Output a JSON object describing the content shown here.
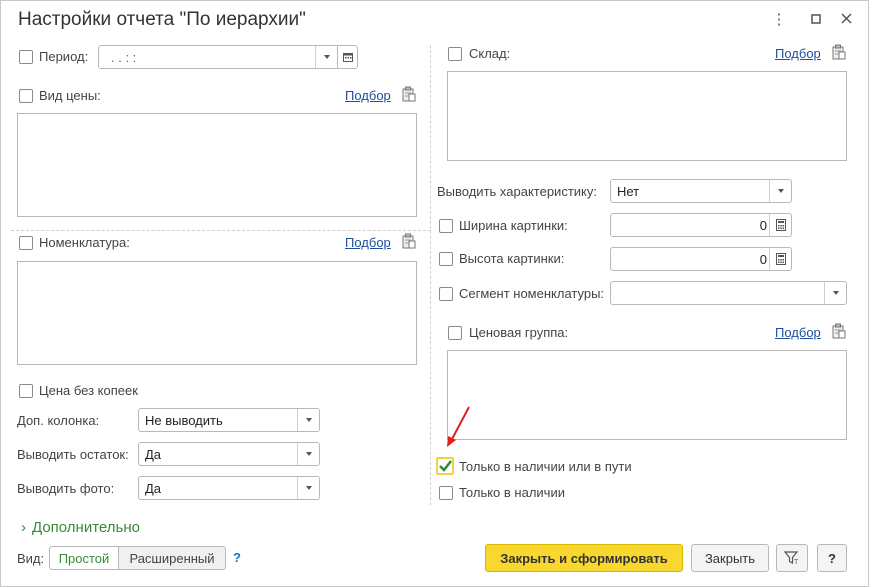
{
  "window": {
    "title": "Настройки отчета \"По иерархии\""
  },
  "left": {
    "period_label": "Период:",
    "period_value": ".  .     :  :",
    "price_type_label": "Вид цены:",
    "nomenclature_label": "Номенклатура:",
    "pick_label": "Подбор",
    "price_no_kopecks_label": "Цена без копеек",
    "extra_column_label": "Доп. колонка:",
    "extra_column_value": "Не выводить",
    "show_balance_label": "Выводить остаток:",
    "show_balance_value": "Да",
    "show_photo_label": "Выводить фото:",
    "show_photo_value": "Да"
  },
  "right": {
    "warehouse_label": "Склад:",
    "pick_label": "Подбор",
    "show_characteristic_label": "Выводить характеристику:",
    "show_characteristic_value": "Нет",
    "image_width_label": "Ширина картинки:",
    "image_width_value": "0",
    "image_height_label": "Высота картинки:",
    "image_height_value": "0",
    "segment_label": "Сегмент номенклатуры:",
    "segment_value": "",
    "price_group_label": "Ценовая группа:",
    "in_stock_or_transit_label": "Только в наличии или в пути",
    "in_stock_label": "Только в наличии"
  },
  "footer": {
    "more_label": "Дополнительно",
    "view_label": "Вид:",
    "view_simple": "Простой",
    "view_extended": "Расширенный",
    "help": "?",
    "close_and_build": "Закрыть и сформировать",
    "close": "Закрыть",
    "help_button": "?"
  },
  "colors": {
    "accent_yellow": "#f8d72e",
    "link_blue": "#1f4d9e",
    "green": "#3a8a3a",
    "annotation_red": "#e0201b"
  }
}
